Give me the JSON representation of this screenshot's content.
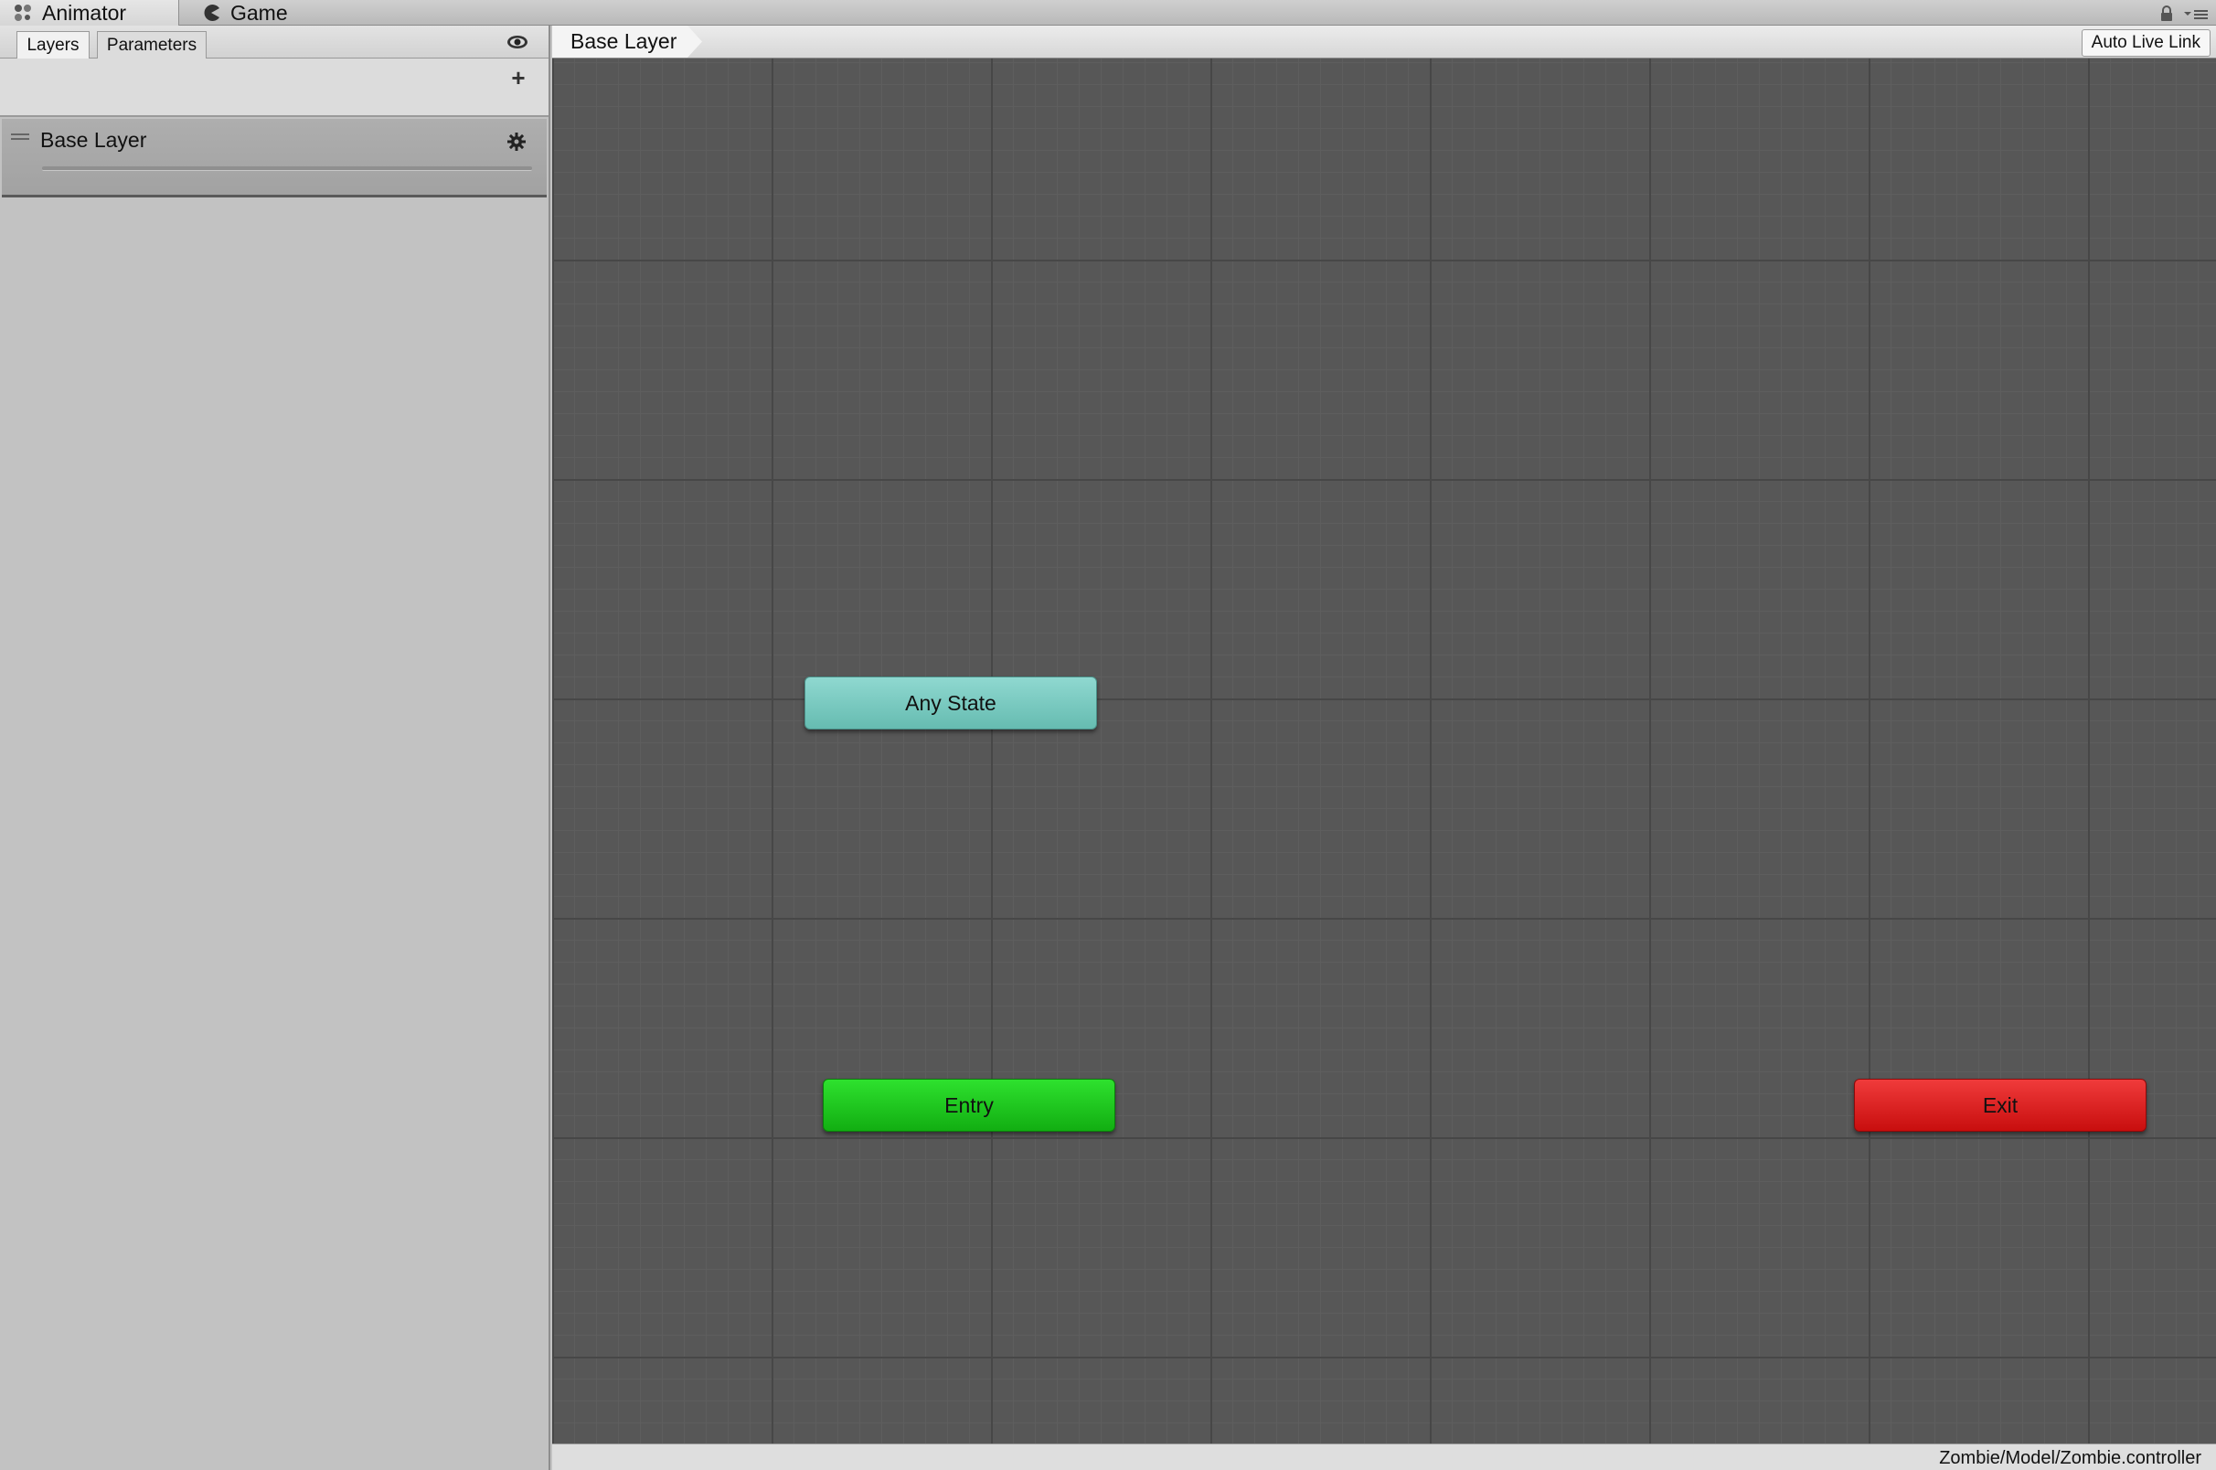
{
  "window_tabs": {
    "active": {
      "label": "Animator",
      "icon": "animator-icon"
    },
    "inactive": {
      "label": "Game",
      "icon": "pacman-icon"
    }
  },
  "left_panel": {
    "tabs": [
      {
        "label": "Layers",
        "selected": true
      },
      {
        "label": "Parameters",
        "selected": false
      }
    ],
    "eye_icon": "eye-icon",
    "add_button": "+",
    "layers": [
      {
        "name": "Base Layer",
        "settings_icon": "gear-icon"
      }
    ]
  },
  "graph": {
    "breadcrumb": "Base Layer",
    "auto_live_link": "Auto Live Link",
    "nodes": {
      "any_state": {
        "label": "Any State",
        "color": "#7acac1"
      },
      "entry": {
        "label": "Entry",
        "color": "#1fc81f"
      },
      "exit": {
        "label": "Exit",
        "color": "#e02222"
      }
    },
    "background_color": "#575757"
  },
  "status": {
    "path": "Zombie/Model/Zombie.controller"
  }
}
